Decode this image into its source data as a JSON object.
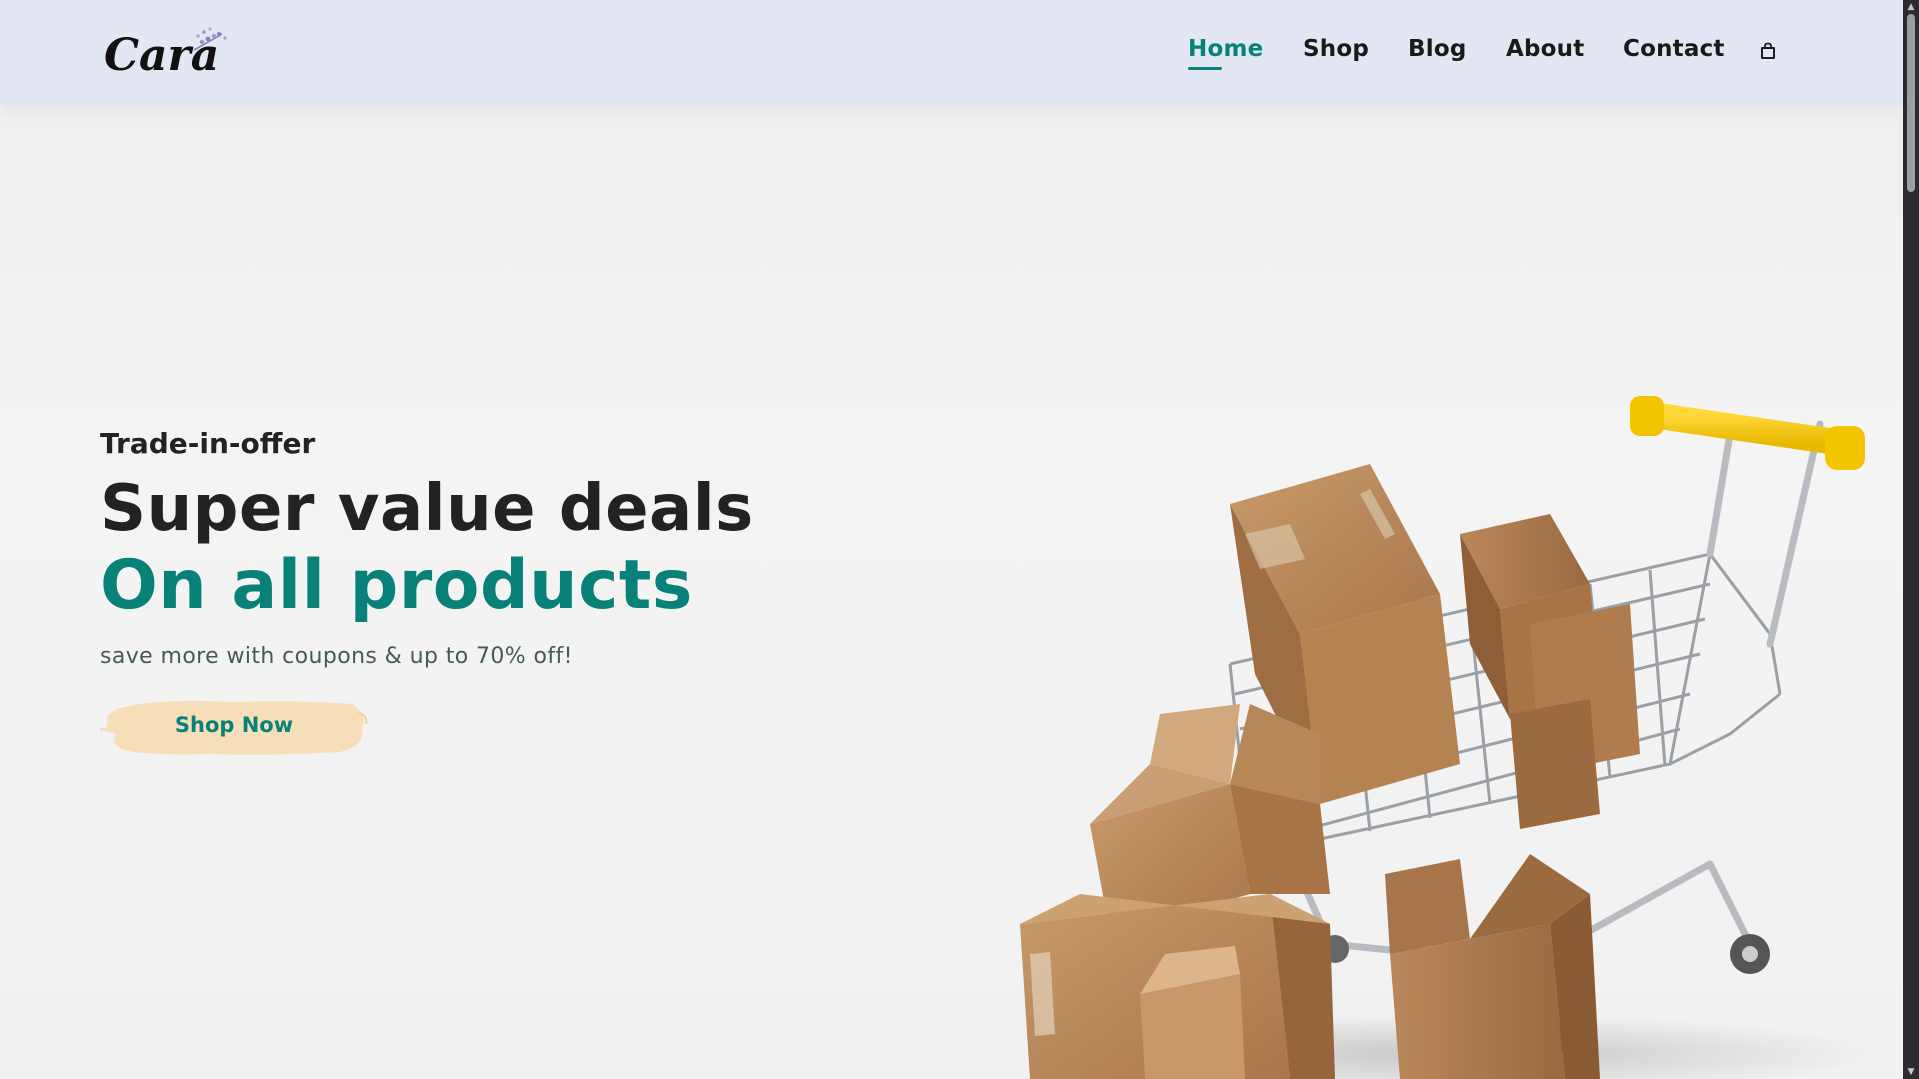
{
  "brand": {
    "logo_text": "Cara"
  },
  "nav": {
    "items": [
      {
        "label": "Home",
        "active": true
      },
      {
        "label": "Shop",
        "active": false
      },
      {
        "label": "Blog",
        "active": false
      },
      {
        "label": "About",
        "active": false
      },
      {
        "label": "Contact",
        "active": false
      }
    ],
    "cart_icon": "shopping-bag-icon"
  },
  "hero": {
    "kicker": "Trade-in-offer",
    "headline_line1": "Super value deals",
    "headline_line2": "On all products",
    "subtitle": "save more with coupons & up to 70% off!",
    "button_label": "Shop Now"
  },
  "colors": {
    "accent": "#088178",
    "header_bg": "#e3e6f3",
    "button_brush": "#f6dfb8",
    "text_dark": "#222222"
  }
}
